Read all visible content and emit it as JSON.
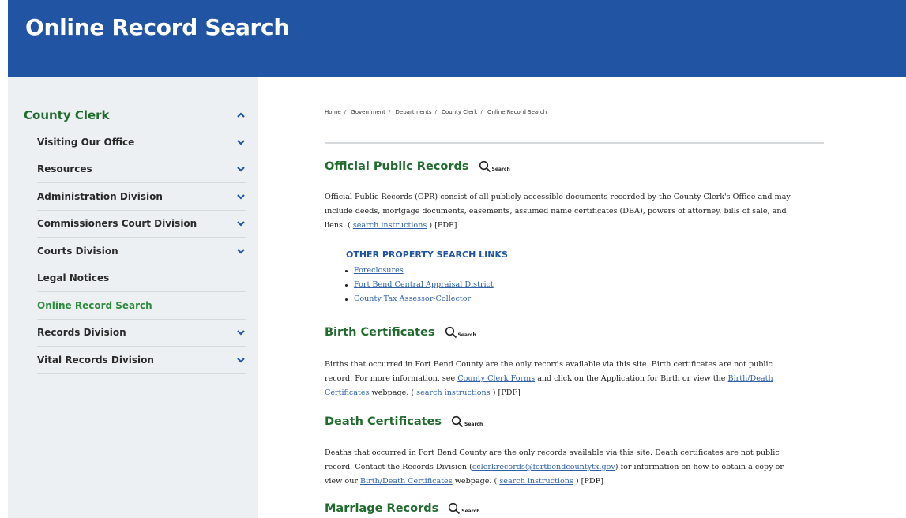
{
  "header": {
    "title": "Online Record Search"
  },
  "sidebar": {
    "heading": "County Clerk",
    "items": [
      {
        "label": "Visiting Our Office",
        "expandable": true
      },
      {
        "label": "Resources",
        "expandable": true
      },
      {
        "label": "Administration Division",
        "expandable": true
      },
      {
        "label": "Commissioners Court Division",
        "expandable": true
      },
      {
        "label": "Courts Division",
        "expandable": true
      },
      {
        "label": "Legal Notices",
        "expandable": false
      },
      {
        "label": "Online Record Search",
        "expandable": false,
        "active": true
      },
      {
        "label": "Records Division",
        "expandable": true
      },
      {
        "label": "Vital Records Division",
        "expandable": true
      }
    ]
  },
  "breadcrumb": [
    "Home",
    "Government",
    "Departments",
    "County Clerk",
    "Online Record Search"
  ],
  "search_label": "Search",
  "sections": {
    "opr": {
      "title": "Official Public Records",
      "text_line1": "Official Public Records (OPR) consist of all publicly accessible documents recorded by the County Clerk's Office and may",
      "text_line2": "include deeds, mortgage documents, easements, assumed name certificates (DBA), powers of attorney, bills of sale, and",
      "text_line3_a": "liens. (",
      "link_search_instructions": "search instructions",
      "text_line3_b": ") [PDF]"
    },
    "other": {
      "title": "OTHER PROPERTY SEARCH LINKS",
      "links": [
        "Foreclosures",
        "Fort Bend Central Appraisal District",
        "County Tax Assessor-Collector"
      ]
    },
    "birth": {
      "title": "Birth Certificates",
      "l1": "Births that occurred in Fort Bend County are the only records available via this site. Birth certificates are not public",
      "l2_a": "record. For more information, see",
      "l2_link": "County Clerk Forms",
      "l2_b": "and click on the Application for Birth or view the",
      "l2_link2": "Birth/Death",
      "l3_link": "Certificates",
      "l3_a": "webpage. (",
      "l3_link2": "search instructions",
      "l3_b": ") [PDF]"
    },
    "death": {
      "title": "Death Certificates",
      "l1": "Deaths that occurred in Fort Bend County are the only records available via this site. Death certificates are not public",
      "l2_a": "record. Contact the Records Division (",
      "l2_link": "cclerkrecords@fortbendcountytx.gov",
      "l2_b": ") for information on how to obtain a copy or",
      "l3_a": "view our",
      "l3_link": "Birth/Death Certificates",
      "l3_b": "webpage. (",
      "l3_link2": "search instructions",
      "l3_c": ") [PDF]"
    },
    "marriage": {
      "title": "Marriage Records"
    }
  },
  "colors": {
    "banner": "#2155a3",
    "heading_green": "#216b2e",
    "link": "#3061a8",
    "sidebar_bg": "#edf0f2"
  }
}
